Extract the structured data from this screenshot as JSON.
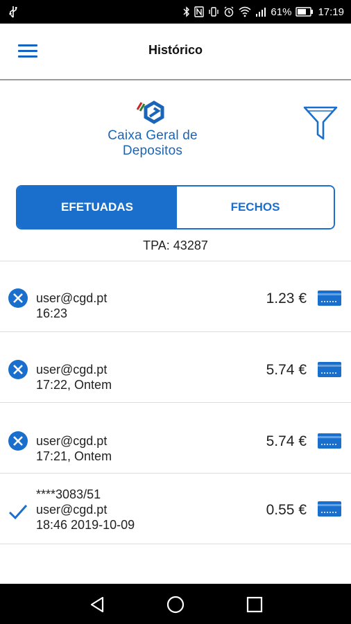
{
  "status_bar": {
    "left_icon": "usb-icon",
    "battery": "61%",
    "time": "17:19"
  },
  "app_bar": {
    "title": "Histórico",
    "menu_icon": "menu-icon"
  },
  "logo": {
    "text": "Caixa Geral de Depositos",
    "icon": "cgd-logo-icon"
  },
  "filter_icon": "filter-icon",
  "tabs": [
    {
      "label": "EFETUADAS",
      "active": true
    },
    {
      "label": "FECHOS",
      "active": false
    }
  ],
  "tpa": "TPA: 43287",
  "transactions": [
    {
      "status_icon": "cancelled-x-icon",
      "lines": [
        "user@cgd.pt",
        "16:23"
      ],
      "amount": "1.23 €",
      "payment_icon": "card-icon"
    },
    {
      "status_icon": "cancelled-x-icon",
      "lines": [
        "user@cgd.pt",
        "17:22, Ontem"
      ],
      "amount": "5.74 €",
      "payment_icon": "card-icon"
    },
    {
      "status_icon": "cancelled-x-icon",
      "lines": [
        "user@cgd.pt",
        "17:21, Ontem"
      ],
      "amount": "5.74 €",
      "payment_icon": "card-icon"
    },
    {
      "status_icon": "checkmark-icon",
      "lines": [
        "****3083/51",
        "user@cgd.pt",
        "18:46  2019-10-09"
      ],
      "amount": "0.55 €",
      "payment_icon": "card-icon"
    }
  ],
  "colors": {
    "primary": "#1a6fcc",
    "text": "#222222"
  }
}
